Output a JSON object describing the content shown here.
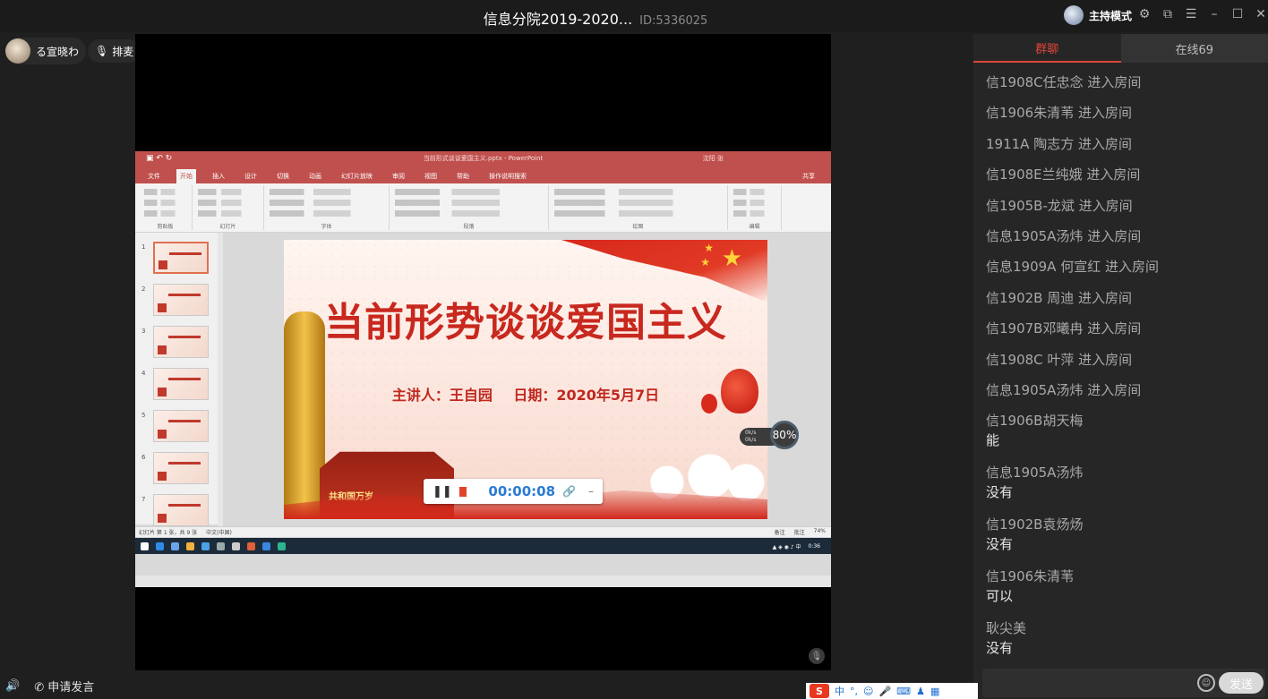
{
  "window": {
    "title": "信息分院2019-2020...",
    "room_id": "ID:5336025",
    "host_mode_label": "主持模式"
  },
  "user": {
    "name": "る宣晓わ",
    "queue_label": "排麦"
  },
  "stage": {
    "ppt": {
      "file_title": "当前形式谈谈爱国主义.pptx - PowerPoint",
      "user": "沈阳 张",
      "menus": [
        "文件",
        "开始",
        "插入",
        "设计",
        "切换",
        "动画",
        "幻灯片放映",
        "审阅",
        "视图",
        "帮助",
        "操作说明搜索"
      ],
      "active_menu": "开始",
      "share": "共享",
      "ribbon_groups": [
        "剪贴板",
        "幻灯片",
        "字体",
        "段落",
        "绘图",
        "编辑"
      ],
      "slide_numbers": [
        "1",
        "2",
        "3",
        "4",
        "5",
        "6",
        "7"
      ],
      "slide": {
        "title": "当前形势谈谈爱国主义",
        "subtitle": "主讲人：王自园   日期：2020年5月7日",
        "banner": "共和国万岁"
      },
      "status_left": "幻灯片 第 1 张，共 9 张",
      "status_lang": "中文(中国)",
      "status_notes": "备注",
      "status_comments": "批注",
      "zoom": "74%",
      "clock": "0:36",
      "net_up": "0k/s",
      "net_down": "0k/s",
      "net_percent": "80%"
    },
    "recorder": {
      "time": "00:00:08"
    }
  },
  "chat": {
    "tab_group": "群聊",
    "tab_online": "在线69",
    "messages": [
      {
        "line": "信1908C任忠念 进入房间"
      },
      {
        "line": "信1906朱清苇 进入房间"
      },
      {
        "line": "1911A  陶志方 进入房间"
      },
      {
        "line": "信1908E兰纯娥 进入房间"
      },
      {
        "line": "信1905B-龙斌 进入房间"
      },
      {
        "line": "信息1905A汤炜 进入房间"
      },
      {
        "line": "信息1909A  何宣红 进入房间"
      },
      {
        "line": "信1902B     周迪 进入房间"
      },
      {
        "line": "信1907B邓曦冉 进入房间"
      },
      {
        "line": "信1908C 叶萍 进入房间"
      },
      {
        "line": "信息1905A汤炜 进入房间"
      },
      {
        "line": "信1906B胡天梅",
        "text": "能"
      },
      {
        "line": "信息1905A汤炜",
        "text": "没有"
      },
      {
        "line": "信1902B袁炀炀",
        "text": "没有"
      },
      {
        "line": "信1906朱清苇",
        "text": "可以"
      },
      {
        "line": "耿尖美",
        "text": "没有"
      }
    ],
    "send_label": "发送"
  },
  "bottom": {
    "speak_label": "申请发言"
  },
  "ime": {
    "label": "中"
  },
  "colors": {
    "accent": "#e0453a",
    "ppt_red": "#c0504d",
    "slide_red": "#c8281e"
  }
}
